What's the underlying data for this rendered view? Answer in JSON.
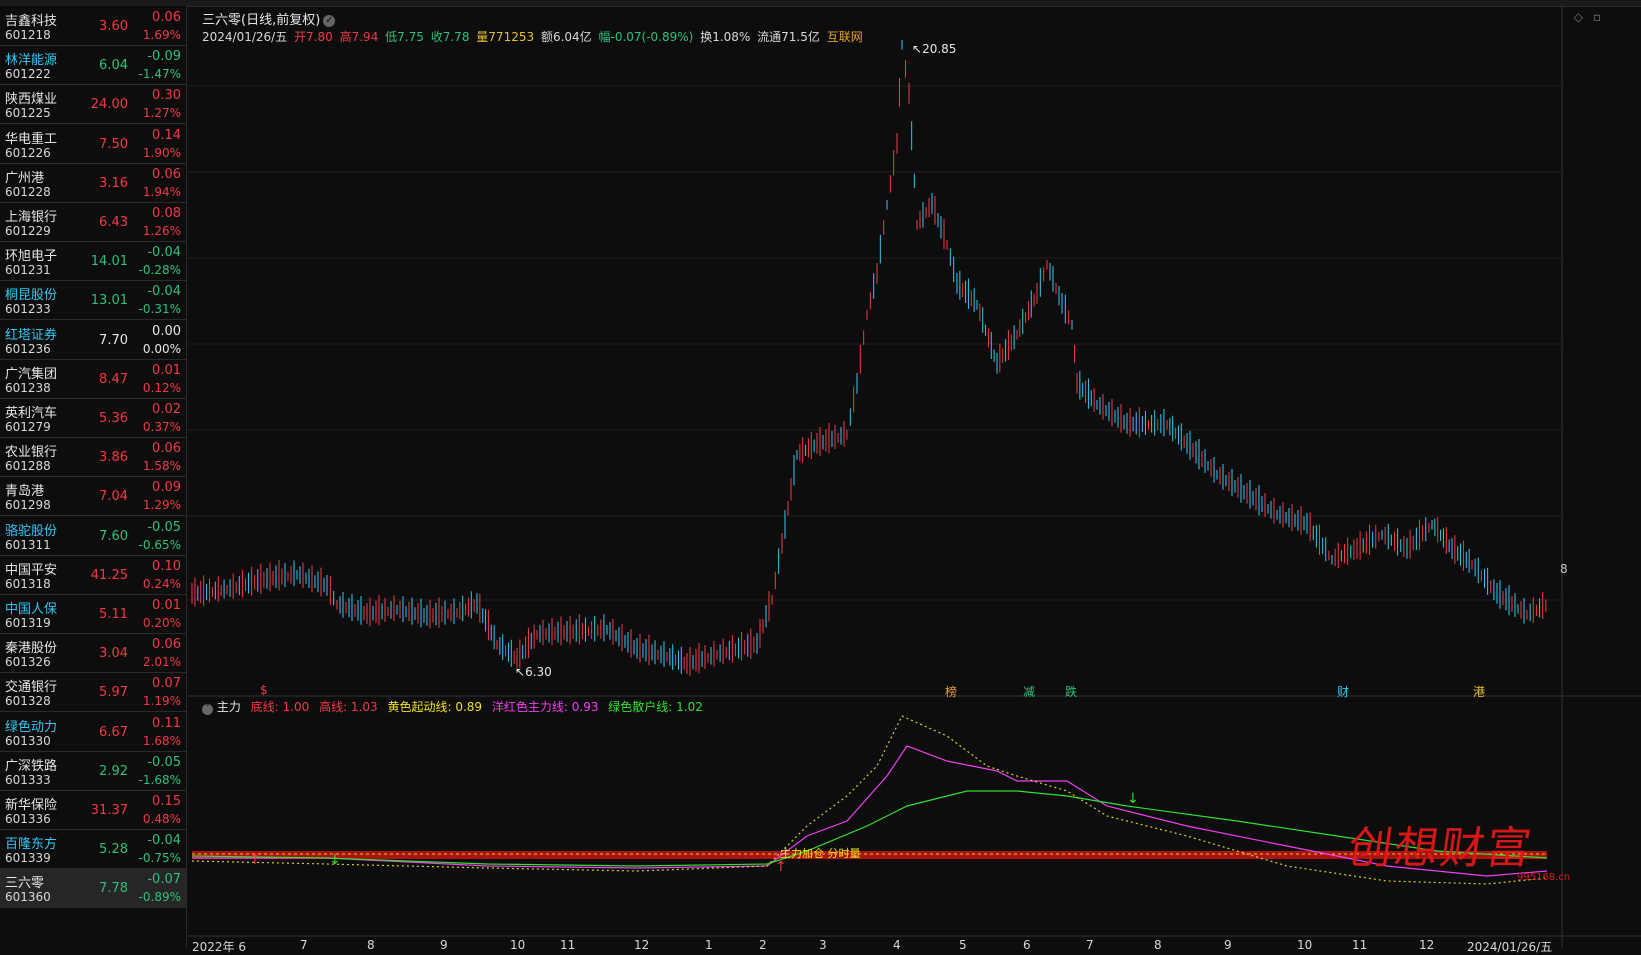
{
  "stock_list": [
    {
      "name": "吉鑫科技",
      "code": "601218",
      "price": "3.60",
      "change": "0.06",
      "pct": "1.69%",
      "dir": "up",
      "name_color": "white"
    },
    {
      "name": "林洋能源",
      "code": "601222",
      "price": "6.04",
      "change": "-0.09",
      "pct": "-1.47%",
      "dir": "dn",
      "name_color": "cyan"
    },
    {
      "name": "陕西煤业",
      "code": "601225",
      "price": "24.00",
      "change": "0.30",
      "pct": "1.27%",
      "dir": "up",
      "name_color": "white"
    },
    {
      "name": "华电重工",
      "code": "601226",
      "price": "7.50",
      "change": "0.14",
      "pct": "1.90%",
      "dir": "up",
      "name_color": "white"
    },
    {
      "name": "广州港",
      "code": "601228",
      "price": "3.16",
      "change": "0.06",
      "pct": "1.94%",
      "dir": "up",
      "name_color": "white"
    },
    {
      "name": "上海银行",
      "code": "601229",
      "price": "6.43",
      "change": "0.08",
      "pct": "1.26%",
      "dir": "up",
      "name_color": "white"
    },
    {
      "name": "环旭电子",
      "code": "601231",
      "price": "14.01",
      "change": "-0.04",
      "pct": "-0.28%",
      "dir": "dn",
      "name_color": "white"
    },
    {
      "name": "桐昆股份",
      "code": "601233",
      "price": "13.01",
      "change": "-0.04",
      "pct": "-0.31%",
      "dir": "dn",
      "name_color": "cyan"
    },
    {
      "name": "红塔证券",
      "code": "601236",
      "price": "7.70",
      "change": "0.00",
      "pct": "0.00%",
      "dir": "flat",
      "name_color": "cyan"
    },
    {
      "name": "广汽集团",
      "code": "601238",
      "price": "8.47",
      "change": "0.01",
      "pct": "0.12%",
      "dir": "up",
      "name_color": "white"
    },
    {
      "name": "英利汽车",
      "code": "601279",
      "price": "5.36",
      "change": "0.02",
      "pct": "0.37%",
      "dir": "up",
      "name_color": "white"
    },
    {
      "name": "农业银行",
      "code": "601288",
      "price": "3.86",
      "change": "0.06",
      "pct": "1.58%",
      "dir": "up",
      "name_color": "white"
    },
    {
      "name": "青岛港",
      "code": "601298",
      "price": "7.04",
      "change": "0.09",
      "pct": "1.29%",
      "dir": "up",
      "name_color": "white"
    },
    {
      "name": "骆驼股份",
      "code": "601311",
      "price": "7.60",
      "change": "-0.05",
      "pct": "-0.65%",
      "dir": "dn",
      "name_color": "cyan"
    },
    {
      "name": "中国平安",
      "code": "601318",
      "price": "41.25",
      "change": "0.10",
      "pct": "0.24%",
      "dir": "up",
      "name_color": "white"
    },
    {
      "name": "中国人保",
      "code": "601319",
      "price": "5.11",
      "change": "0.01",
      "pct": "0.20%",
      "dir": "up",
      "name_color": "cyan"
    },
    {
      "name": "秦港股份",
      "code": "601326",
      "price": "3.04",
      "change": "0.06",
      "pct": "2.01%",
      "dir": "up",
      "name_color": "white"
    },
    {
      "name": "交通银行",
      "code": "601328",
      "price": "5.97",
      "change": "0.07",
      "pct": "1.19%",
      "dir": "up",
      "name_color": "white"
    },
    {
      "name": "绿色动力",
      "code": "601330",
      "price": "6.67",
      "change": "0.11",
      "pct": "1.68%",
      "dir": "up",
      "name_color": "cyan"
    },
    {
      "name": "广深铁路",
      "code": "601333",
      "price": "2.92",
      "change": "-0.05",
      "pct": "-1.68%",
      "dir": "dn",
      "name_color": "white"
    },
    {
      "name": "新华保险",
      "code": "601336",
      "price": "31.37",
      "change": "0.15",
      "pct": "0.48%",
      "dir": "up",
      "name_color": "white"
    },
    {
      "name": "百隆东方",
      "code": "601339",
      "price": "5.28",
      "change": "-0.04",
      "pct": "-0.75%",
      "dir": "dn",
      "name_color": "cyan"
    },
    {
      "name": "三六零",
      "code": "601360",
      "price": "7.78",
      "change": "-0.07",
      "pct": "-0.89%",
      "dir": "dn",
      "name_color": "white",
      "selected": true
    }
  ],
  "chart": {
    "title": "三六零(日线,前复权)",
    "quote": {
      "date": "2024/01/26/五",
      "open": "开7.80",
      "high": "高7.94",
      "low": "低7.75",
      "close": "收7.78",
      "volume": "量771253",
      "amount": "额6.04亿",
      "amplitude": "幅-0.07(-0.89%)",
      "turnover": "换1.08%",
      "float": "流通71.5亿",
      "source": "互联网"
    },
    "high_marker": "20.85",
    "low_marker": "6.30",
    "right_scale_label": "8",
    "events": [
      {
        "label": "榜",
        "color": "#e8a028"
      },
      {
        "label": "减",
        "color": "#2fc07a"
      },
      {
        "label": "跌",
        "color": "#2fc07a"
      },
      {
        "label": "财",
        "color": "#35c6f5"
      },
      {
        "label": "港",
        "color": "#e8c12a"
      },
      {
        "label": "$",
        "color": "#f03a46"
      }
    ],
    "indicator": {
      "name": "主力",
      "bottom_line": "底线: 1.00",
      "high_line": "高线: 1.03",
      "yellow_line": "黄色起动线: 0.89",
      "magenta_line": "洋红色主力线: 0.93",
      "green_line": "绿色散户线: 1.02",
      "signal_text": "主力加仓 分时量"
    },
    "x_axis_labels": [
      "2022年 6",
      "7",
      "8",
      "9",
      "10",
      "11",
      "12",
      "1",
      "2",
      "3",
      "4",
      "5",
      "6",
      "7",
      "8",
      "9",
      "10",
      "11",
      "12",
      "2024/01/26/五"
    ],
    "watermark": "创想财富",
    "watermark_url": "995168.cn"
  }
}
